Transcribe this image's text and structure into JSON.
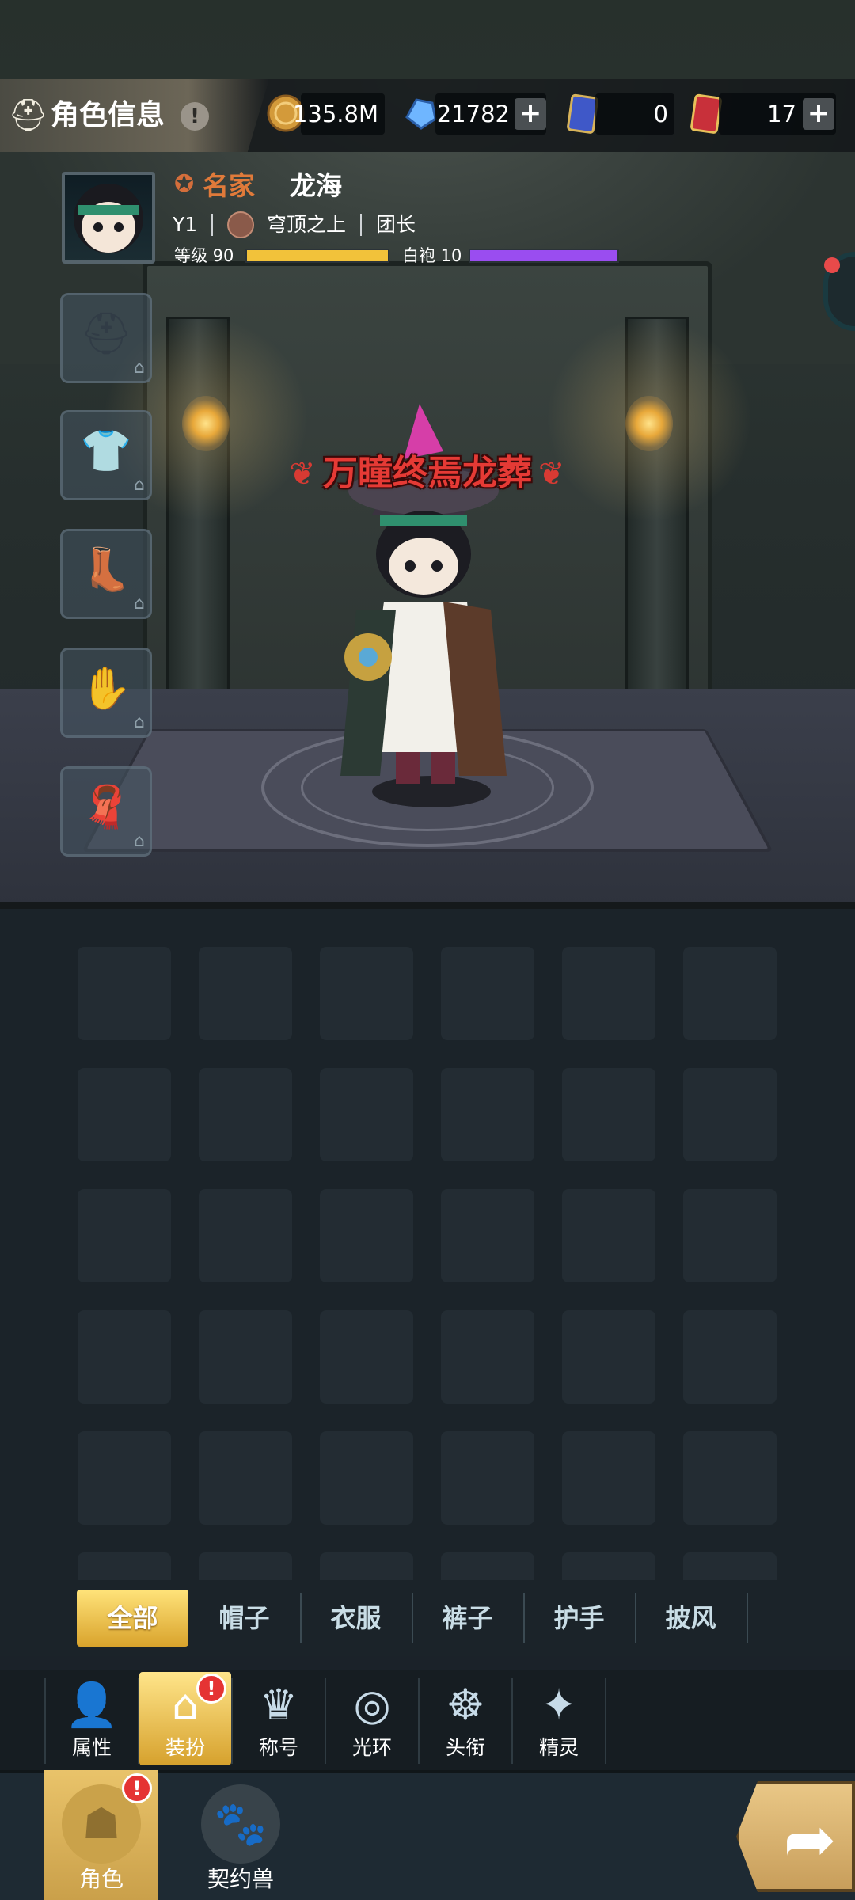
{
  "header": {
    "title": "角色信息",
    "title_icon": "character-info-icon",
    "alert": "!",
    "resources": [
      {
        "name": "gold-coin-icon",
        "value": "135.8M"
      },
      {
        "name": "blue-crystal-icon",
        "value": "21782",
        "addable": true
      },
      {
        "name": "blue-card-icon",
        "value": "0"
      },
      {
        "name": "red-card-icon",
        "value": "17",
        "addable": true
      }
    ]
  },
  "player": {
    "rank_title": "名家",
    "name": "龙海",
    "server": "Y1",
    "guild": "穹顶之上",
    "role": "团长",
    "level_label": "等级 90",
    "level_progress": 1.0,
    "robe_label": "白袍 10",
    "robe_progress": 1.0
  },
  "character_title": "万瞳终焉龙葬",
  "equipment_slots": [
    {
      "name": "helmet-slot",
      "icon": "helmet-icon"
    },
    {
      "name": "armor-slot",
      "icon": "shirt-icon"
    },
    {
      "name": "pants-slot",
      "icon": "boots-icon"
    },
    {
      "name": "gloves-slot",
      "icon": "glove-icon"
    },
    {
      "name": "cape-slot",
      "icon": "cape-icon"
    }
  ],
  "filter_tabs": [
    {
      "label": "全部",
      "active": true
    },
    {
      "label": "帽子"
    },
    {
      "label": "衣服"
    },
    {
      "label": "裤子"
    },
    {
      "label": "护手"
    },
    {
      "label": "披风"
    }
  ],
  "sub_tabs": [
    {
      "label": "属性",
      "icon": "person-icon"
    },
    {
      "label": "装扮",
      "icon": "hanger-icon",
      "active": true,
      "badge": "!"
    },
    {
      "label": "称号",
      "icon": "crown-icon"
    },
    {
      "label": "光环",
      "icon": "halo-icon"
    },
    {
      "label": "头衔",
      "icon": "emblem-icon"
    },
    {
      "label": "精灵",
      "icon": "spirit-icon"
    }
  ],
  "bottom_nav": [
    {
      "label": "角色",
      "icon": "character-hood-icon",
      "active": true,
      "badge": "!"
    },
    {
      "label": "契约兽",
      "icon": "paw-icon"
    }
  ],
  "colors": {
    "accent_gold": "#d9a32c",
    "level_bar": "#f2c23a",
    "robe_bar": "#9a4df0",
    "badge_red": "#e53333",
    "rank_orange": "#e07a3a",
    "title_red": "#e53a35"
  }
}
